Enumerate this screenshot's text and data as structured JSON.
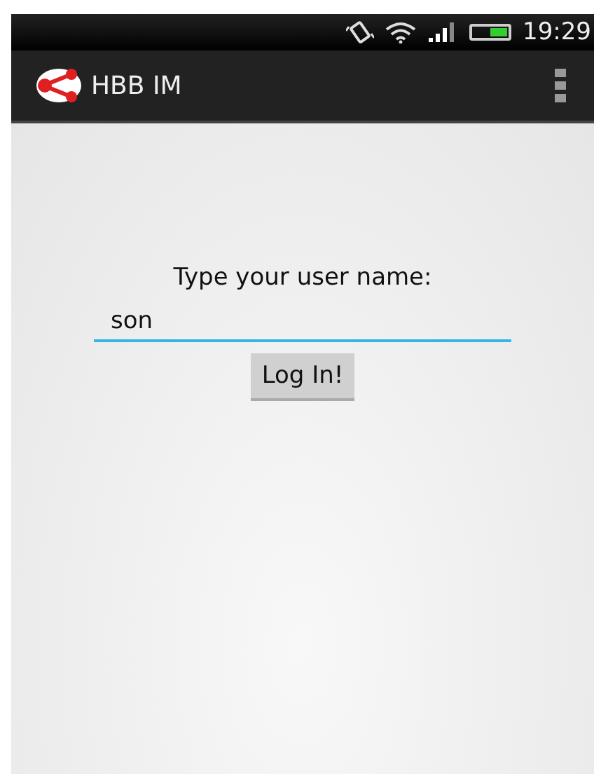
{
  "status_bar": {
    "time": "19:29",
    "battery": {
      "level": 0.5
    }
  },
  "action_bar": {
    "title": "HBB IM"
  },
  "login": {
    "prompt": "Type your user name:",
    "username": {
      "value": "son"
    },
    "button": "Log In!"
  }
}
